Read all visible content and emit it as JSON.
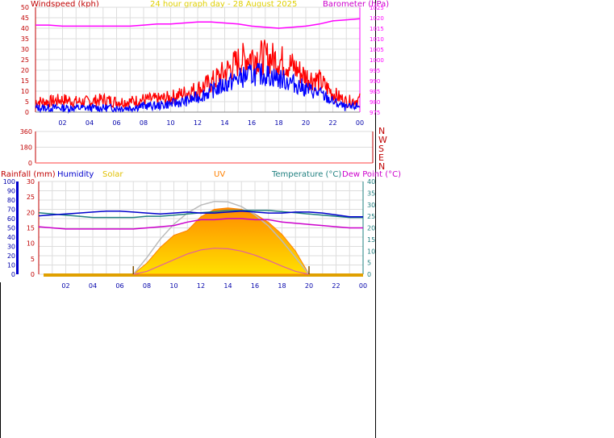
{
  "header": {
    "windspeed_label": "Windspeed (kph)",
    "title": "24 hour graph day - 28 August 2025",
    "barometer_label": "Barometer (hPa)"
  },
  "legend": {
    "rainfall": "Rainfall (mm)",
    "humidity": "Humidity",
    "solar": "Solar",
    "uv": "UV",
    "temperature": "Temperature (°C)",
    "dewpoint": "Dew Point (°C)"
  },
  "colors": {
    "wind_gust": "#ff0000",
    "wind_avg": "#0000ff",
    "barometer": "#ff00ff",
    "rainfall": "#c00000",
    "humidity": "#0000cc",
    "solar": "#e0c000",
    "uv": "#ff8000",
    "temperature": "#208080",
    "dewpoint": "#cc00cc",
    "grid": "#dddddd",
    "axis_tick": "#0000aa"
  },
  "chart_data": [
    {
      "type": "line",
      "name": "wind-barometer",
      "title": "24 hour graph day - 28 August 2025",
      "ylabel": "Windspeed (kph)",
      "ylabel2": "Barometer (hPa)",
      "x_ticks": [
        "02",
        "04",
        "06",
        "08",
        "10",
        "12",
        "14",
        "16",
        "18",
        "20",
        "22",
        "00"
      ],
      "y_ticks": [
        0,
        5,
        10,
        15,
        20,
        25,
        30,
        35,
        40,
        45,
        50
      ],
      "y2_ticks": [
        975,
        980,
        985,
        990,
        995,
        1000,
        1005,
        1010,
        1015,
        1020,
        1025
      ],
      "ylim": [
        0,
        50
      ],
      "y2lim": [
        975,
        1025
      ],
      "x": [
        0,
        1,
        2,
        3,
        4,
        5,
        6,
        7,
        8,
        9,
        10,
        11,
        12,
        13,
        14,
        15,
        16,
        17,
        18,
        19,
        20,
        21,
        22,
        23,
        24
      ],
      "series": [
        {
          "name": "gust",
          "values": [
            5,
            5,
            6,
            5,
            5,
            6,
            5,
            5,
            6,
            6,
            7,
            9,
            11,
            14,
            19,
            24,
            27,
            26,
            25,
            22,
            17,
            15,
            9,
            5,
            6
          ]
        },
        {
          "name": "average",
          "values": [
            2,
            2,
            2,
            2,
            2,
            2,
            2,
            2,
            3,
            3,
            4,
            5,
            7,
            10,
            13,
            16,
            18,
            18,
            16,
            14,
            11,
            9,
            5,
            2,
            3
          ]
        },
        {
          "name": "barometer",
          "values": [
            1016.5,
            1016.5,
            1016,
            1016,
            1016,
            1016,
            1016,
            1016,
            1016.5,
            1017,
            1017,
            1017.5,
            1018,
            1018,
            1017.5,
            1017,
            1016,
            1015.5,
            1015,
            1015.5,
            1016,
            1017,
            1018.5,
            1019,
            1019.5
          ]
        }
      ]
    },
    {
      "type": "scatter",
      "name": "wind-direction",
      "y_ticks": [
        0,
        180,
        360
      ],
      "ylim": [
        0,
        360
      ],
      "compass_labels": [
        "N",
        "W",
        "S",
        "E",
        "N"
      ]
    },
    {
      "type": "line",
      "name": "temp-humidity-solar",
      "x_ticks": [
        "02",
        "04",
        "06",
        "08",
        "10",
        "12",
        "14",
        "16",
        "18",
        "20",
        "22",
        "00"
      ],
      "y_ticks_humidity": [
        0,
        10,
        20,
        30,
        40,
        50,
        60,
        70,
        80,
        90,
        100
      ],
      "y_ticks_rain": [
        0,
        5,
        10,
        15,
        20,
        25,
        30
      ],
      "y_ticks_temp": [
        0,
        5,
        10,
        15,
        20,
        25,
        30,
        35,
        40
      ],
      "x": [
        0,
        1,
        2,
        3,
        4,
        5,
        6,
        7,
        8,
        9,
        10,
        11,
        12,
        13,
        14,
        15,
        16,
        17,
        18,
        19,
        20,
        21,
        22,
        23,
        24
      ],
      "series": [
        {
          "name": "temperature",
          "values": [
            26.5,
            26,
            25.5,
            25,
            24.5,
            24.5,
            24.5,
            24.5,
            25,
            25,
            25.5,
            26,
            26.5,
            27,
            27.5,
            27.5,
            27.5,
            27.5,
            27,
            26.5,
            26,
            25.5,
            25,
            24.5,
            24.5
          ]
        },
        {
          "name": "humidity",
          "values": [
            63,
            64,
            65,
            66,
            67,
            68,
            68,
            67,
            66,
            65,
            66,
            67,
            66,
            66,
            67,
            68,
            67,
            66,
            66,
            67,
            67,
            66,
            64,
            62,
            62
          ]
        },
        {
          "name": "dewpoint",
          "values": [
            20.5,
            20,
            19.5,
            19.5,
            19.5,
            19.5,
            19.5,
            19.5,
            20,
            20.5,
            21,
            22.5,
            23.5,
            23.5,
            24,
            24,
            23.5,
            23.5,
            22.5,
            22,
            21.5,
            21,
            20.5,
            20,
            20
          ]
        },
        {
          "name": "solar",
          "values": [
            0,
            0,
            0,
            0,
            0,
            0,
            0,
            0,
            120,
            290,
            420,
            470,
            620,
            700,
            715,
            700,
            650,
            560,
            430,
            250,
            0,
            0,
            0,
            0,
            0
          ]
        },
        {
          "name": "solar-max",
          "values": [
            0,
            0,
            0,
            0,
            0,
            0,
            0,
            0,
            180,
            380,
            540,
            660,
            745,
            785,
            780,
            730,
            640,
            520,
            360,
            180,
            0,
            0,
            0,
            0,
            0
          ]
        },
        {
          "name": "uv",
          "values": [
            0,
            0,
            0,
            0,
            0,
            0,
            0,
            0,
            0.5,
            1.5,
            2.5,
            3.5,
            4.2,
            4.5,
            4.4,
            4.0,
            3.3,
            2.4,
            1.4,
            0.5,
            0,
            0,
            0,
            0,
            0
          ]
        }
      ],
      "sunrise_hour": 7,
      "sunset_hour": 20
    }
  ]
}
